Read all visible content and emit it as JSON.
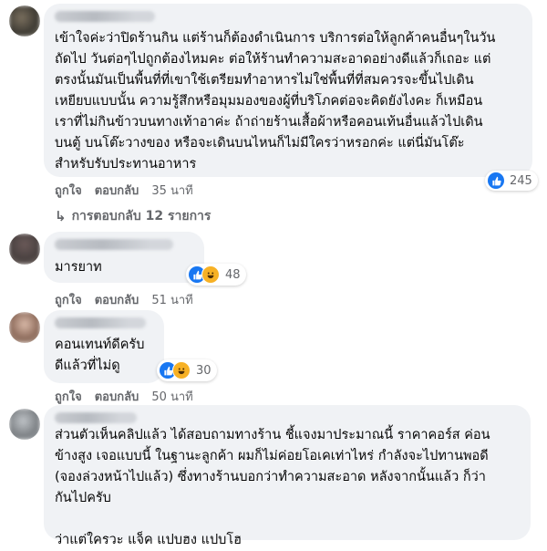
{
  "comments": [
    {
      "text": "เข้าใจค่ะว่าปิดร้านกิน แต่ร้านก็ต้องดำเนินการ บริการต่อให้ลูกค้าคนอื่นๆในวัน\nถัดไป วันต่อๆไปถูกต้องไหมคะ ต่อให้ร้านทำความสะอาดอย่างดีแล้วก็เถอะ แต่\nตรงนั้นมันเป็นพื้นที่ที่เขาใช้เตรียมทำอาหารไม่ใช่พื้นที่ที่สมควรจะขึ้นไปเดิน\nเหยียบแบบนั้น ความรู้สึกหรือมุมมองของผู้ที่บริโภคต่อจะคิดยังไงคะ ก็เหมือน\nเราที่ไม่กินข้าวบนทางเท้าอาค่ะ ถ้าถ่ายร้านเสื้อผ้าหรือคอนเท้นอื่นแล้วไปเดิน\nบนตู้ บนโต๊ะวางของ หรือจะเดินบนไหนก็ไม่มีใครว่าหรอกค่ะ แต่นี่มันโต๊ะ\nสำหรับรับประทานอาหาร",
      "reaction_count": "245",
      "like_label": "ถูกใจ",
      "reply_label": "ตอบกลับ",
      "time": "35 นาที"
    },
    {
      "text": "มารยาท",
      "reaction_count": "48",
      "like_label": "ถูกใจ",
      "reply_label": "ตอบกลับ",
      "time": "51 นาที"
    },
    {
      "text": "คอนเทนท์ดีครับ\nดีแล้วที่ไม่ดู",
      "reaction_count": "30",
      "like_label": "ถูกใจ",
      "reply_label": "ตอบกลับ",
      "time": "50 นาที"
    },
    {
      "text": "ส่วนตัวเห็นคลิปแล้ว ได้สอบถามทางร้าน ชี้แจงมาประมาณนี้ ราคาคอร์ส ค่อน\nข้างสูง เจอแบบนี้ ในฐานะลูกค้า ผมก็ไม่ค่อยโอเคเท่าไหร่ กำลังจะไปทานพอดี\n(จองล่วงหน้าไปแล้ว) ซึ่งทางร้านบอกว่าทำความสะอาด หลังจากนั้นแล้ว ก็ว่า\nกันไปครับ\n\nว่าแต่ใครวะ แจ็ค แปบฮง แปบโฮ"
    }
  ],
  "replies_label": "การตอบกลับ 12 รายการ",
  "colors": {
    "like": "#1877f2",
    "haha": "#f7b125",
    "bubble": "#f0f2f5",
    "meta": "#65676b"
  }
}
